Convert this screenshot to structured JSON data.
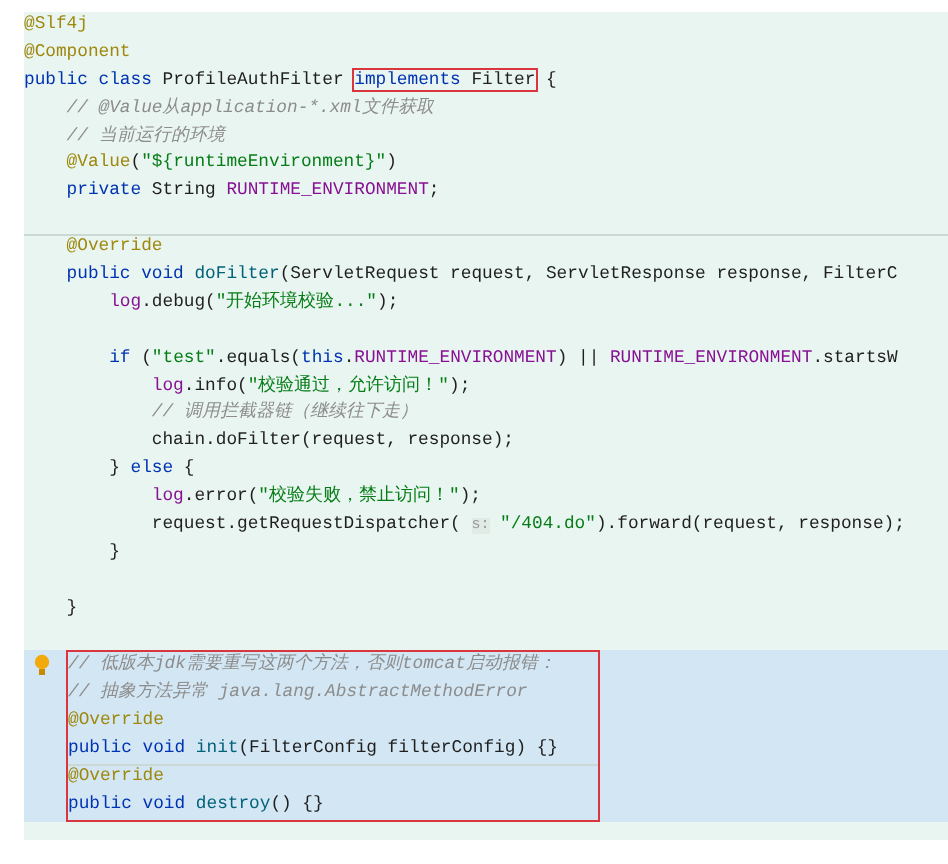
{
  "editor": {
    "blocks": [
      {
        "boxed": false,
        "highlighted": false,
        "lines": [
          {
            "tokens": [
              {
                "text": "@Slf4j",
                "kind": "annotation"
              }
            ]
          },
          {
            "tokens": [
              {
                "text": "@Component",
                "kind": "annotation"
              }
            ]
          },
          {
            "tokens": [
              {
                "text": "public class",
                "kind": "keyword"
              },
              {
                "text": " ProfileAuthFilter ",
                "kind": "plain"
              },
              {
                "boxed": true,
                "tokens": [
                  {
                    "text": "implements",
                    "kind": "keyword"
                  },
                  {
                    "text": " Filter",
                    "kind": "plain"
                  }
                ]
              },
              {
                "text": " {",
                "kind": "plain"
              }
            ]
          },
          {
            "tokens": [
              {
                "text": "    // @Value从application-*.xml文件获取",
                "kind": "comment"
              }
            ]
          },
          {
            "tokens": [
              {
                "text": "    // 当前运行的环境",
                "kind": "comment"
              }
            ]
          },
          {
            "tokens": [
              {
                "text": "    @Value",
                "kind": "annotation"
              },
              {
                "text": "(",
                "kind": "plain"
              },
              {
                "text": "\"${runtimeEnvironment}\"",
                "kind": "string"
              },
              {
                "text": ")",
                "kind": "plain"
              }
            ]
          },
          {
            "tokens": [
              {
                "text": "    private",
                "kind": "keyword"
              },
              {
                "text": " String ",
                "kind": "plain"
              },
              {
                "text": "RUNTIME_ENVIRONMENT",
                "kind": "field"
              },
              {
                "text": ";",
                "kind": "plain"
              }
            ]
          },
          {
            "kind": "blank"
          },
          {
            "separator": true,
            "tokens": [
              {
                "text": "    @Override",
                "kind": "annotation"
              }
            ]
          },
          {
            "tokens": [
              {
                "text": "    public void ",
                "kind": "keyword"
              },
              {
                "text": "doFilter",
                "kind": "method"
              },
              {
                "text": "(ServletRequest request, ServletResponse response, FilterC",
                "kind": "plain"
              }
            ]
          },
          {
            "tokens": [
              {
                "text": "        log",
                "kind": "field"
              },
              {
                "text": ".debug(",
                "kind": "plain"
              },
              {
                "text": "\"开始环境校验...\"",
                "kind": "string"
              },
              {
                "text": ");",
                "kind": "plain"
              }
            ]
          },
          {
            "kind": "blank"
          },
          {
            "tokens": [
              {
                "text": "        if",
                "kind": "keyword"
              },
              {
                "text": " (",
                "kind": "plain"
              },
              {
                "text": "\"test\"",
                "kind": "string"
              },
              {
                "text": ".equals(",
                "kind": "plain"
              },
              {
                "text": "this",
                "kind": "keyword"
              },
              {
                "text": ".",
                "kind": "plain"
              },
              {
                "text": "RUNTIME_ENVIRONMENT",
                "kind": "field"
              },
              {
                "text": ") || ",
                "kind": "plain"
              },
              {
                "text": "RUNTIME_ENVIRONMENT",
                "kind": "field"
              },
              {
                "text": ".startsW",
                "kind": "plain"
              }
            ]
          },
          {
            "tokens": [
              {
                "text": "            log",
                "kind": "field"
              },
              {
                "text": ".info(",
                "kind": "plain"
              },
              {
                "text": "\"校验通过，允许访问！\"",
                "kind": "string"
              },
              {
                "text": ");",
                "kind": "plain"
              }
            ]
          },
          {
            "tokens": [
              {
                "text": "            // 调用拦截器链（继续往下走）",
                "kind": "comment"
              }
            ]
          },
          {
            "tokens": [
              {
                "text": "            chain.doFilter(request, response);",
                "kind": "plain"
              }
            ]
          },
          {
            "tokens": [
              {
                "text": "        } ",
                "kind": "plain"
              },
              {
                "text": "else",
                "kind": "keyword"
              },
              {
                "text": " {",
                "kind": "plain"
              }
            ]
          },
          {
            "tokens": [
              {
                "text": "            log",
                "kind": "field"
              },
              {
                "text": ".error(",
                "kind": "plain"
              },
              {
                "text": "\"校验失败，禁止访问！\"",
                "kind": "string"
              },
              {
                "text": ");",
                "kind": "plain"
              }
            ]
          },
          {
            "tokens": [
              {
                "text": "            request.getRequestDispatcher( ",
                "kind": "plain"
              },
              {
                "text": "s:",
                "kind": "hint"
              },
              {
                "text": " \"/404.do\"",
                "kind": "string"
              },
              {
                "text": ").forward(request, response);",
                "kind": "plain"
              }
            ]
          },
          {
            "tokens": [
              {
                "text": "        }",
                "kind": "plain"
              }
            ]
          },
          {
            "kind": "blank"
          },
          {
            "tokens": [
              {
                "text": "    }",
                "kind": "plain"
              }
            ]
          },
          {
            "kind": "blank"
          }
        ]
      },
      {
        "boxed": true,
        "highlighted": true,
        "hint_bulb": true,
        "lines": [
          {
            "tokens": [
              {
                "text": "// 低版本jdk需要重写这两个方法，否则tomcat启动报错：",
                "kind": "comment"
              }
            ]
          },
          {
            "tokens": [
              {
                "text": "// 抽象方法异常 java.lang.AbstractMethodError",
                "kind": "comment"
              }
            ]
          },
          {
            "tokens": [
              {
                "text": "@Override",
                "kind": "annotation"
              }
            ]
          },
          {
            "tokens": [
              {
                "text": "public void ",
                "kind": "keyword"
              },
              {
                "text": "init",
                "kind": "method"
              },
              {
                "text": "(FilterConfig filterConfig) {}",
                "kind": "plain"
              }
            ]
          },
          {
            "separator": true,
            "tokens": [
              {
                "text": "@Override",
                "kind": "annotation"
              }
            ]
          },
          {
            "tokens": [
              {
                "text": "public void ",
                "kind": "keyword"
              },
              {
                "text": "destroy",
                "kind": "method"
              },
              {
                "text": "() {}",
                "kind": "plain"
              }
            ]
          }
        ]
      }
    ]
  }
}
